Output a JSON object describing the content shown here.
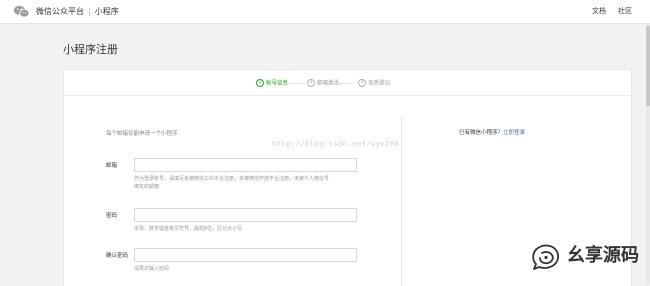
{
  "topbar": {
    "brand": "微信公众平台",
    "separator": "|",
    "section": "小程序",
    "links": {
      "docs": "文档",
      "community": "社区"
    }
  },
  "page": {
    "title": "小程序注册"
  },
  "steps": [
    {
      "num": "1",
      "label": "帐号信息",
      "active": true
    },
    {
      "num": "2",
      "label": "邮箱激活",
      "active": false
    },
    {
      "num": "3",
      "label": "信息登记",
      "active": false
    }
  ],
  "form": {
    "hint": "每个邮箱仅能申请一个小程序",
    "email": {
      "label": "邮箱",
      "value": "",
      "tip_lines": [
        "作为登录帐号，请填写未被微信公众平台注册，未被微信开放平台注册，未被个人微信号",
        "绑定的邮箱"
      ]
    },
    "password": {
      "label": "密码",
      "value": "",
      "tip": "字母、数字或者英文符号，最短8位，区分大小写"
    },
    "confirm_password": {
      "label": "确认密码",
      "value": "",
      "tip": "请再次输入密码"
    }
  },
  "sidebar": {
    "question": "已有微信小程序？",
    "login_link": "立即登录"
  },
  "watermark": "http://blog.csdn.net/wyx100",
  "stamp": {
    "text": "幺享源码",
    "icon": "wechat-official-account-icon"
  },
  "colors": {
    "accent_green": "#1aad19",
    "link_blue": "#576b95"
  }
}
